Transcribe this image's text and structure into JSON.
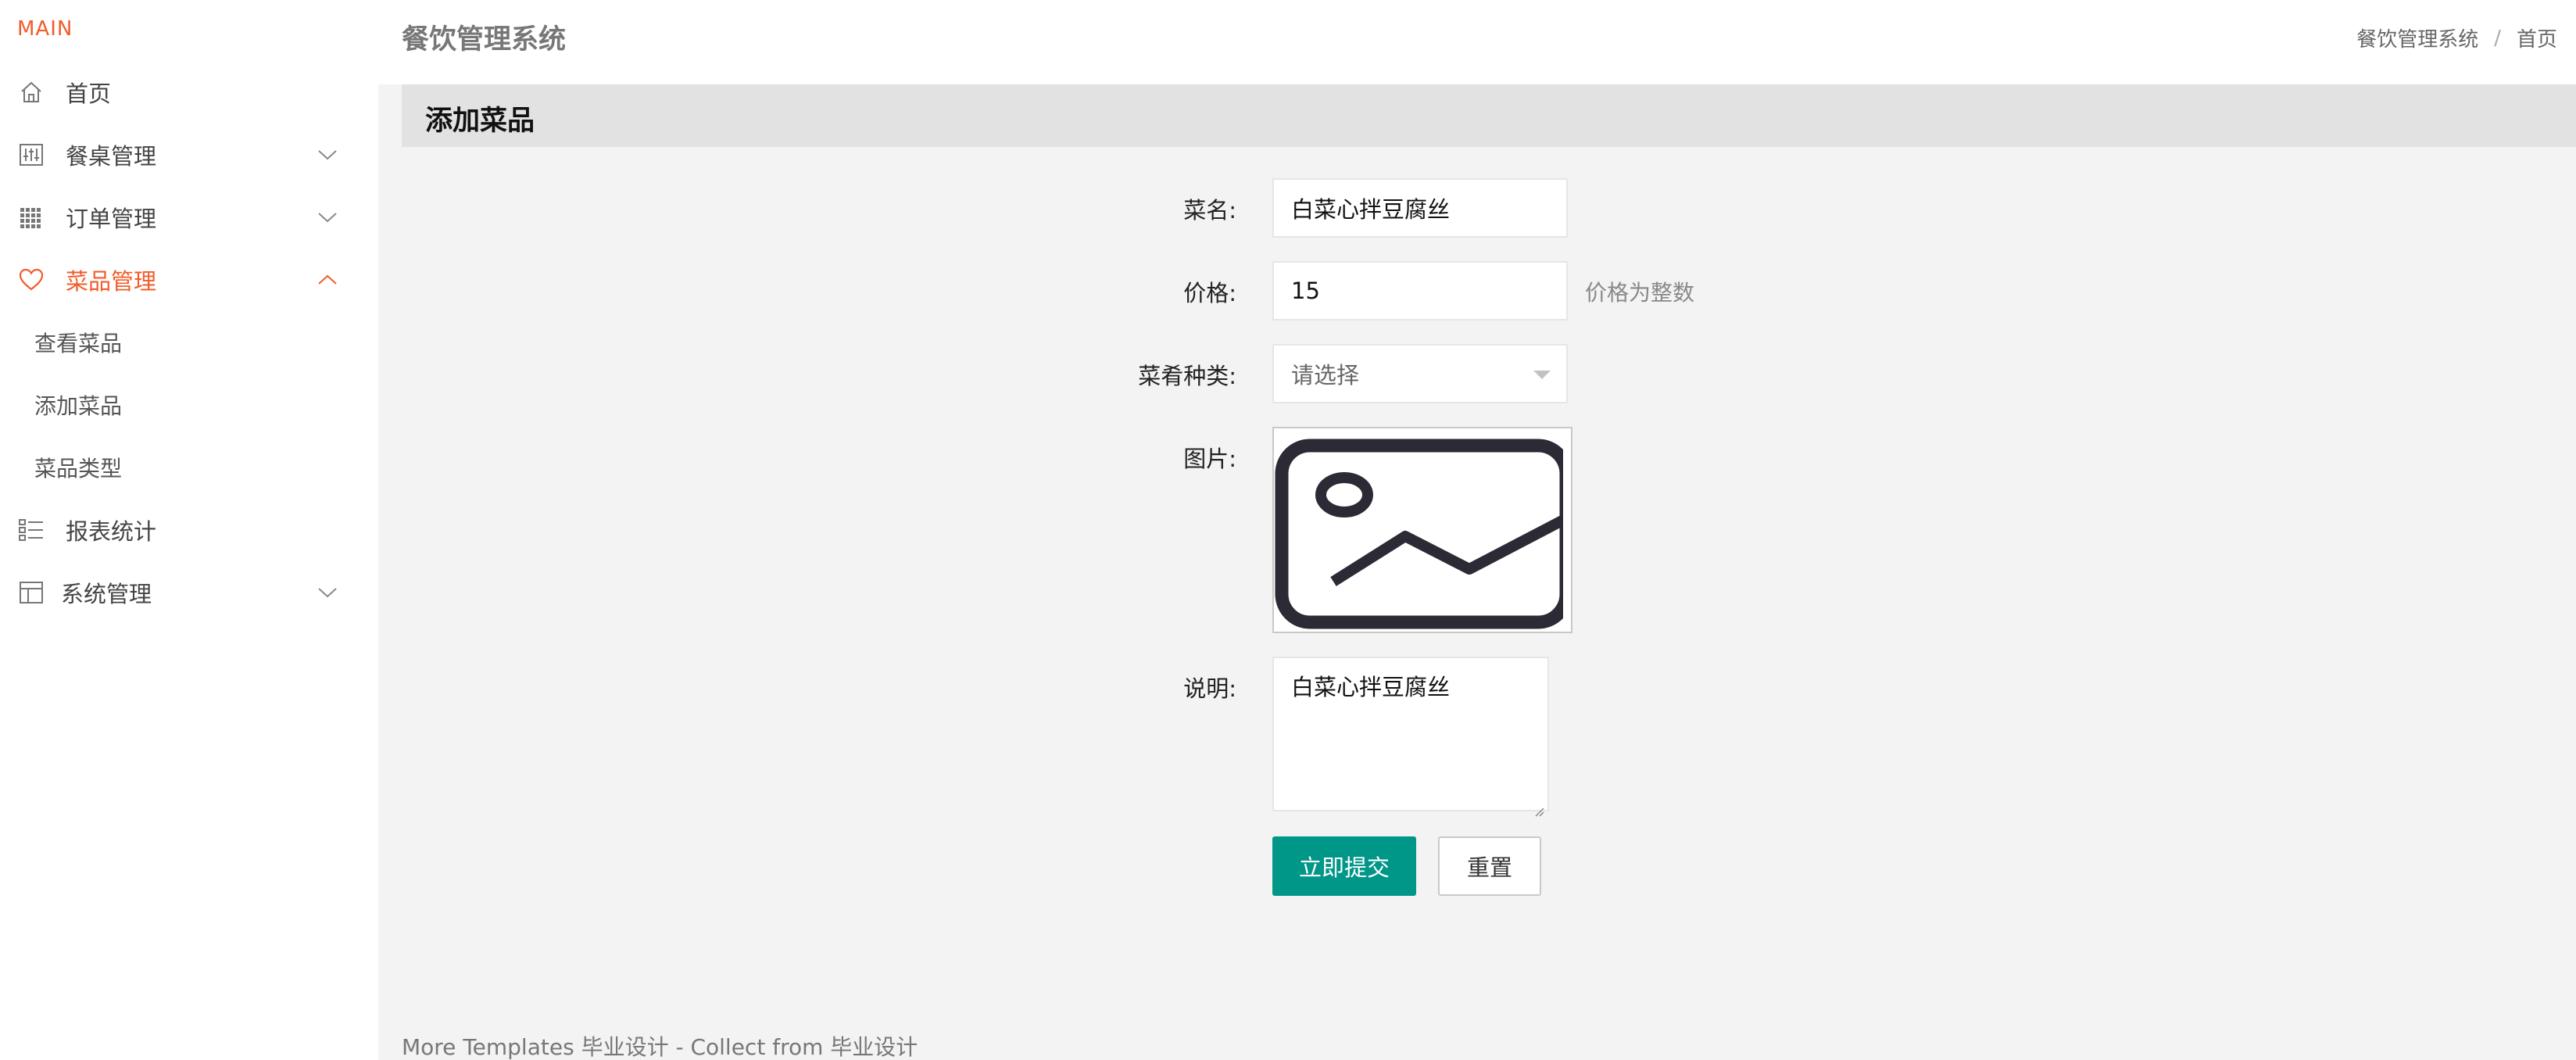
{
  "sidebar": {
    "brand": "MAIN",
    "accent_color": "#f25c2a",
    "items": [
      {
        "label": "首页",
        "icon": "home-icon"
      },
      {
        "label": "餐桌管理",
        "icon": "sliders-icon"
      },
      {
        "label": "订单管理",
        "icon": "grid-icon"
      },
      {
        "label": "菜品管理",
        "icon": "heart-icon",
        "expanded": true
      },
      {
        "label": "报表统计",
        "icon": "list-icon"
      },
      {
        "label": "系统管理",
        "icon": "layout-icon"
      }
    ],
    "sub_items": [
      {
        "label": "查看菜品"
      },
      {
        "label": "添加菜品"
      },
      {
        "label": "菜品类型"
      }
    ]
  },
  "header": {
    "title": "餐饮管理系统",
    "breadcrumb": [
      "餐饮管理系统",
      "首页"
    ],
    "breadcrumb_sep": "/"
  },
  "panel": {
    "title": "添加菜品"
  },
  "form": {
    "name_label": "菜名:",
    "name_value": "白菜心拌豆腐丝",
    "price_label": "价格:",
    "price_value": "15",
    "price_hint": "价格为整数",
    "category_label": "菜肴种类:",
    "category_placeholder": "请选择",
    "image_label": "图片:",
    "image_icon": "image-placeholder-icon",
    "desc_label": "说明:",
    "desc_value": "白菜心拌豆腐丝",
    "submit_label": "立即提交",
    "reset_label": "重置",
    "primary_color": "#009688"
  },
  "footer": {
    "text": "More Templates 毕业设计 - Collect from 毕业设计"
  }
}
